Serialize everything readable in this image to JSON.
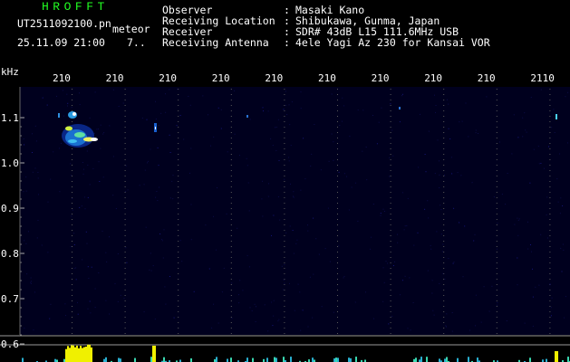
{
  "header": {
    "logo": "HROFFT",
    "filename": "UT2511092100.pn",
    "meteor_label": "meteor",
    "datetime": "25.11.09 21:00",
    "count": "7..",
    "fields": [
      {
        "label": "Observer",
        "value": "Masaki Kano"
      },
      {
        "label": "Receiving Location",
        "value": "Shibukawa, Gunma, Japan"
      },
      {
        "label": "Receiver",
        "value": "SDR# 43dB L15 111.6MHz USB"
      },
      {
        "label": "Receiving Antenna",
        "value": "4ele Yagi Az 230 for Kansai VOR"
      }
    ],
    "colon": ":"
  },
  "plot": {
    "y_unit": "kHz",
    "y_ticks": [
      "1.1",
      "1.0",
      "0.9",
      "0.8",
      "0.7",
      "0.6"
    ],
    "x_ticks": [
      "210",
      "210",
      "210",
      "210",
      "210",
      "210",
      "210",
      "210",
      "210",
      "2110"
    ],
    "background": "#00001e",
    "grid_color": "#5a5a5a"
  }
}
